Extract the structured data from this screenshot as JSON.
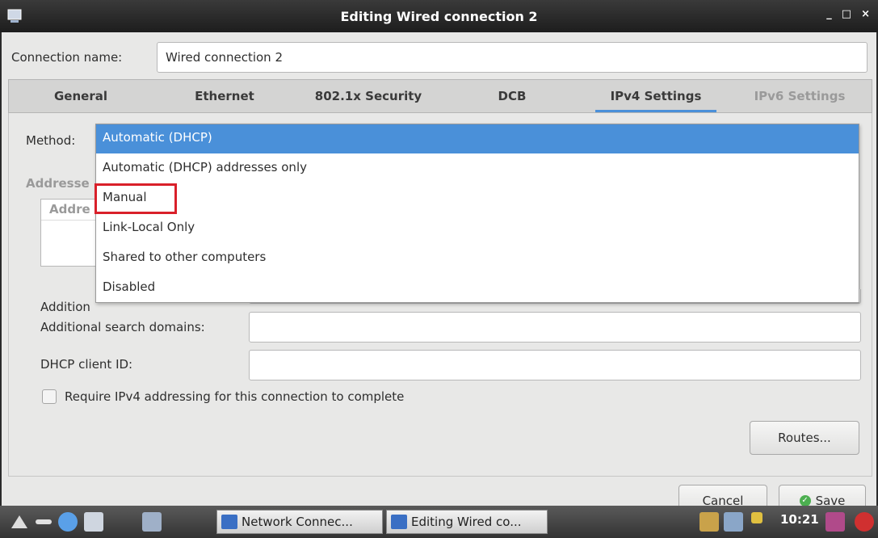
{
  "window": {
    "title": "Editing Wired connection 2",
    "controls": [
      "_",
      "□",
      "×"
    ]
  },
  "connection": {
    "label": "Connection name:",
    "value": "Wired connection 2"
  },
  "tabs": [
    {
      "label": "General",
      "state": "normal"
    },
    {
      "label": "Ethernet",
      "state": "normal"
    },
    {
      "label": "802.1x Security",
      "state": "normal"
    },
    {
      "label": "DCB",
      "state": "normal"
    },
    {
      "label": "IPv4 Settings",
      "state": "active"
    },
    {
      "label": "IPv6 Settings",
      "state": "disabled"
    }
  ],
  "ipv4": {
    "method_label": "Method:",
    "addresses_label": "Addresse",
    "addresses_col_header": "Addre",
    "additional_dns_label": "Addition",
    "search_domains_label": "Additional search domains:",
    "dhcp_client_id_label": "DHCP client ID:",
    "require_checkbox_label": "Require IPv4 addressing for this connection to complete",
    "routes_button": "Routes..."
  },
  "method_dropdown": {
    "selected": "Automatic (DHCP)",
    "options": [
      "Automatic (DHCP)",
      "Automatic (DHCP) addresses only",
      "Manual",
      "Link-Local Only",
      "Shared to other computers",
      "Disabled"
    ],
    "highlighted": "Manual"
  },
  "buttons": {
    "cancel": "Cancel",
    "save": "Save"
  },
  "taskbar": {
    "tasks": [
      "Network Connec...",
      "Editing Wired co..."
    ],
    "clock": "10:21"
  },
  "colors": {
    "accent": "#4a90d9",
    "highlight_box": "#d9202a",
    "save_icon": "#4caf50"
  }
}
